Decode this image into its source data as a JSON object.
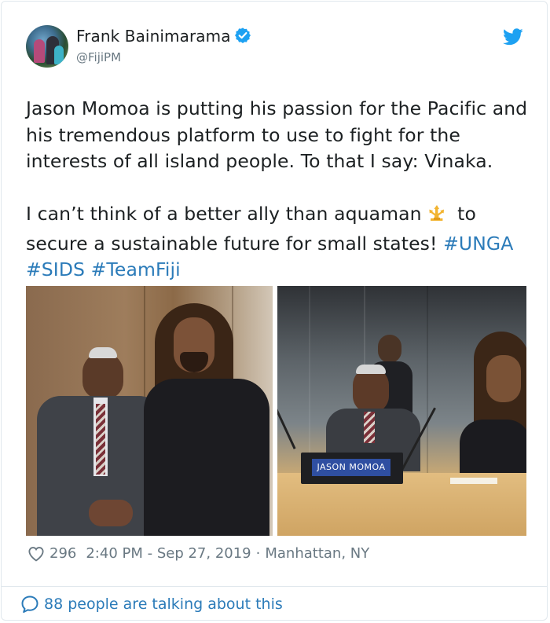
{
  "author": {
    "display_name": "Frank Bainimarama",
    "handle": "@FijiPM",
    "verified": true
  },
  "tweet": {
    "paragraph1": "Jason Momoa is putting his passion for the Pacific and his tremendous platform to use to fight for the interests of all island people. To that I say: Vinaka.",
    "paragraph2_text": "I can’t think of a better ally than aquaman",
    "paragraph2_after_emoji": " to secure a sustainable future for small states! ",
    "emoji": "trident-icon",
    "hashtags": [
      "#UNGA",
      "#SIDS",
      "#TeamFiji"
    ]
  },
  "media": {
    "photo_count": 2,
    "nameplate_text": "JASON MOMOA"
  },
  "footer": {
    "like_count": "296",
    "timestamp": "2:40 PM - Sep 27, 2019",
    "separator": "·",
    "location": "Manhattan, NY"
  },
  "conversation": {
    "label": "88 people are talking about this"
  },
  "colors": {
    "link": "#2b7bb9",
    "meta": "#697882",
    "verified": "#1da1f2",
    "twitter_bird": "#1da1f2",
    "text": "#1c2022"
  },
  "icons": [
    "verified-badge-icon",
    "twitter-bird-icon",
    "heart-icon",
    "speech-bubble-icon",
    "trident-icon"
  ]
}
